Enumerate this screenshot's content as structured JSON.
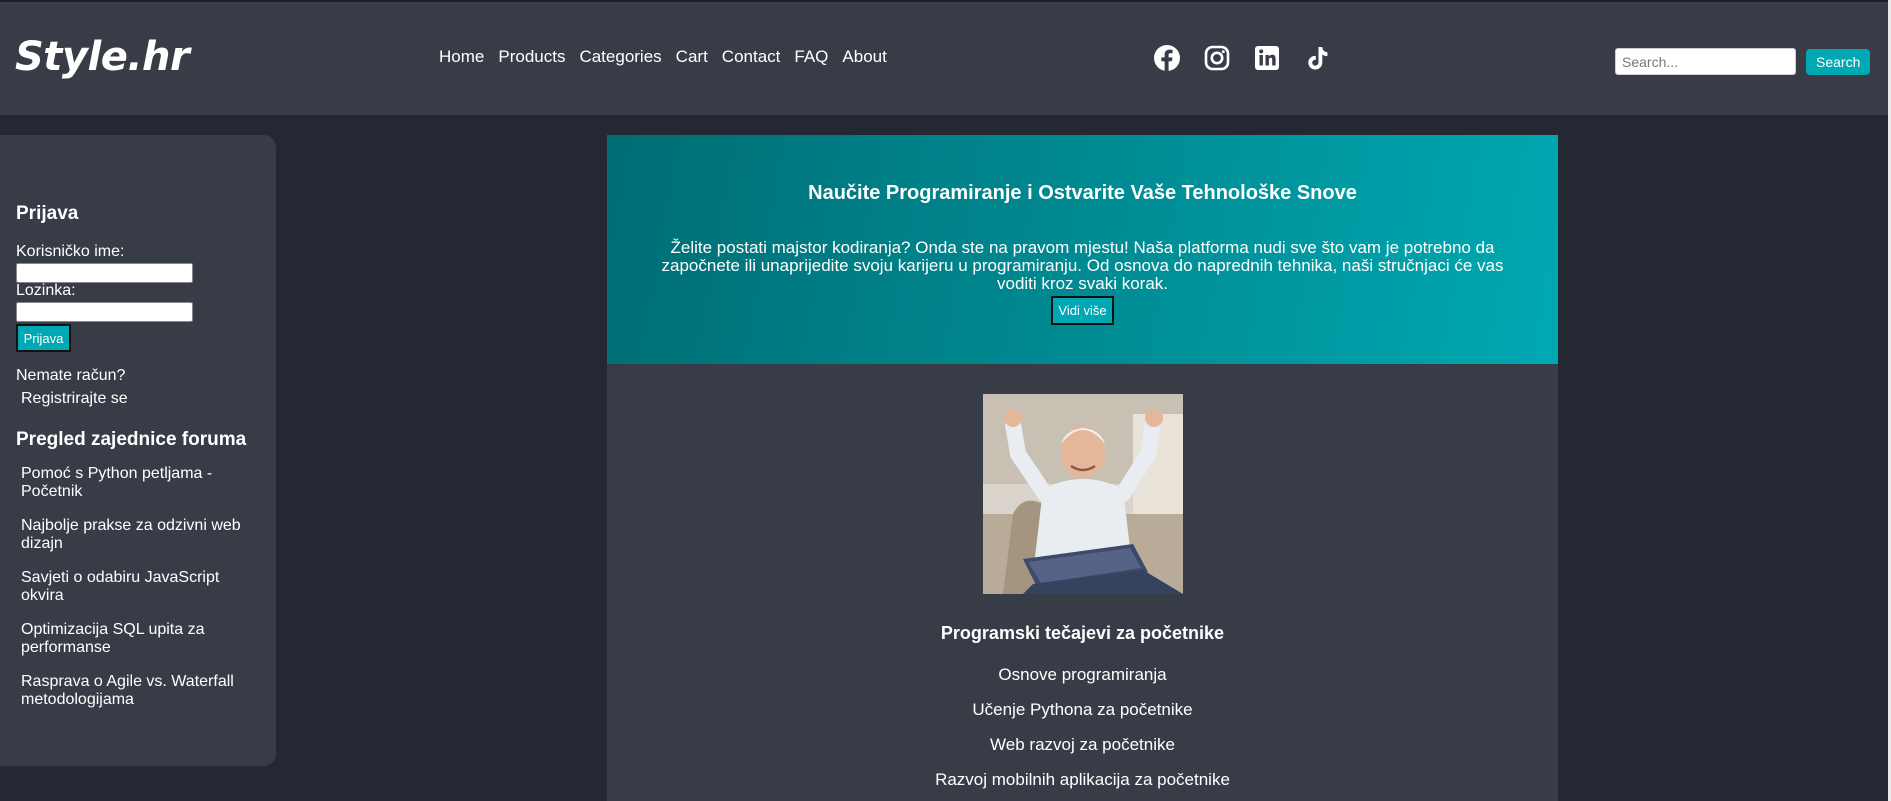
{
  "brand": {
    "logo": "Style.hr"
  },
  "nav": {
    "items": [
      "Home",
      "Products",
      "Categories",
      "Cart",
      "Contact",
      "FAQ",
      "About"
    ]
  },
  "social": {
    "icons": [
      "facebook-icon",
      "instagram-icon",
      "linkedin-icon",
      "tiktok-icon"
    ]
  },
  "search": {
    "placeholder": "Search...",
    "value": "",
    "button_label": "Search"
  },
  "colors": {
    "page_bg": "#232832",
    "panel_bg": "#383c46",
    "accent": "#00a8b4",
    "hero_start": "#006d74",
    "hero_end": "#00a9b2"
  },
  "sidebar": {
    "login_title": "Prijava",
    "username_label": "Korisničko ime:",
    "password_label": "Lozinka:",
    "login_button": "Prijava",
    "no_account": "Nemate račun?",
    "register_link": "Registrirajte se",
    "forum_title": "Pregled zajednice foruma",
    "forum_items": [
      "Pomoć s Python petljama - Početnik",
      "Najbolje prakse za odzivni web dizajn",
      "Savjeti o odabiru JavaScript okvira",
      "Optimizacija SQL upita za performanse",
      "Rasprava o Agile vs. Waterfall metodologijama"
    ]
  },
  "hero": {
    "title": "Naučite Programiranje i Ostvarite Vaše Tehnološke Snove",
    "text": "Želite postati majstor kodiranja? Onda ste na pravom mjestu! Naša platforma nudi sve što vam je potrebno da započnete ili unaprijedite svoju karijeru u programiranju. Od osnova do naprednih tehnika, naši stručnjaci će vas voditi kroz svaki korak.",
    "button": "Vidi više"
  },
  "courses": {
    "title": "Programski tečajevi za početnike",
    "items": [
      "Osnove programiranja",
      "Učenje Pythona za početnike",
      "Web razvoj za početnike",
      "Razvoj mobilnih aplikacija za početnike"
    ]
  }
}
